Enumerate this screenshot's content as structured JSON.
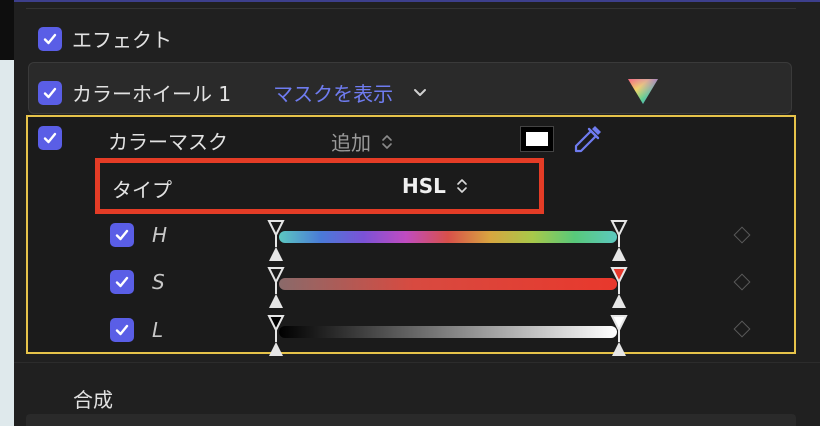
{
  "effects_header": {
    "label": "エフェクト",
    "checked": true
  },
  "color_wheel": {
    "label": "カラーホイール 1",
    "show_mask_link": "マスクを表示",
    "checked": true
  },
  "color_mask": {
    "label": "カラーマスク",
    "blend_mode": "追加",
    "checked": true,
    "swatch_color": "#ffffff"
  },
  "type_row": {
    "label": "タイプ",
    "value": "HSL"
  },
  "sliders": [
    {
      "label": "H",
      "checked": true
    },
    {
      "label": "S",
      "checked": true
    },
    {
      "label": "L",
      "checked": true
    }
  ],
  "composite": {
    "label": "合成"
  },
  "colors": {
    "accent": "#5a5ee6",
    "link": "#6f7cf0",
    "mask_border": "#e6c34a",
    "highlight": "#e43c26"
  }
}
